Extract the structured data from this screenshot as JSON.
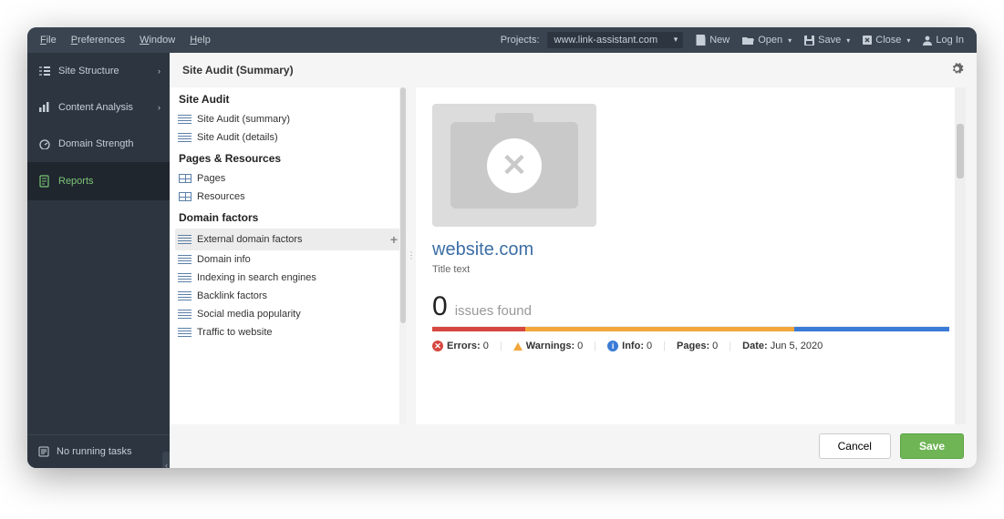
{
  "menubar": {
    "file": "File",
    "preferences": "Preferences",
    "window": "Window",
    "help": "Help",
    "projects_label": "Projects:",
    "project_value": "www.link-assistant.com",
    "new": "New",
    "open": "Open",
    "save": "Save",
    "close": "Close",
    "login": "Log In"
  },
  "sidebar": {
    "site_structure": "Site Structure",
    "content_analysis": "Content Analysis",
    "domain_strength": "Domain Strength",
    "reports": "Reports",
    "tasks": "No running tasks"
  },
  "header": {
    "title": "Site Audit (Summary)"
  },
  "tree": {
    "sec1": "Site Audit",
    "sec1_items": [
      "Site Audit (summary)",
      "Site Audit (details)"
    ],
    "sec2": "Pages & Resources",
    "sec2_items": [
      "Pages",
      "Resources"
    ],
    "sec3": "Domain factors",
    "sec3_items": [
      "External domain factors",
      "Domain info",
      "Indexing in search engines",
      "Backlink factors",
      "Social media popularity",
      "Traffic to website"
    ]
  },
  "summary": {
    "site": "website.com",
    "title_text": "Title text",
    "issues_count": "0",
    "issues_label": "issues found",
    "errors_label": "Errors:",
    "errors_val": "0",
    "warnings_label": "Warnings:",
    "warnings_val": "0",
    "info_label": "Info:",
    "info_val": "0",
    "pages_label": "Pages:",
    "pages_val": "0",
    "date_label": "Date:",
    "date_val": "Jun 5, 2020"
  },
  "footer": {
    "cancel": "Cancel",
    "save": "Save"
  }
}
